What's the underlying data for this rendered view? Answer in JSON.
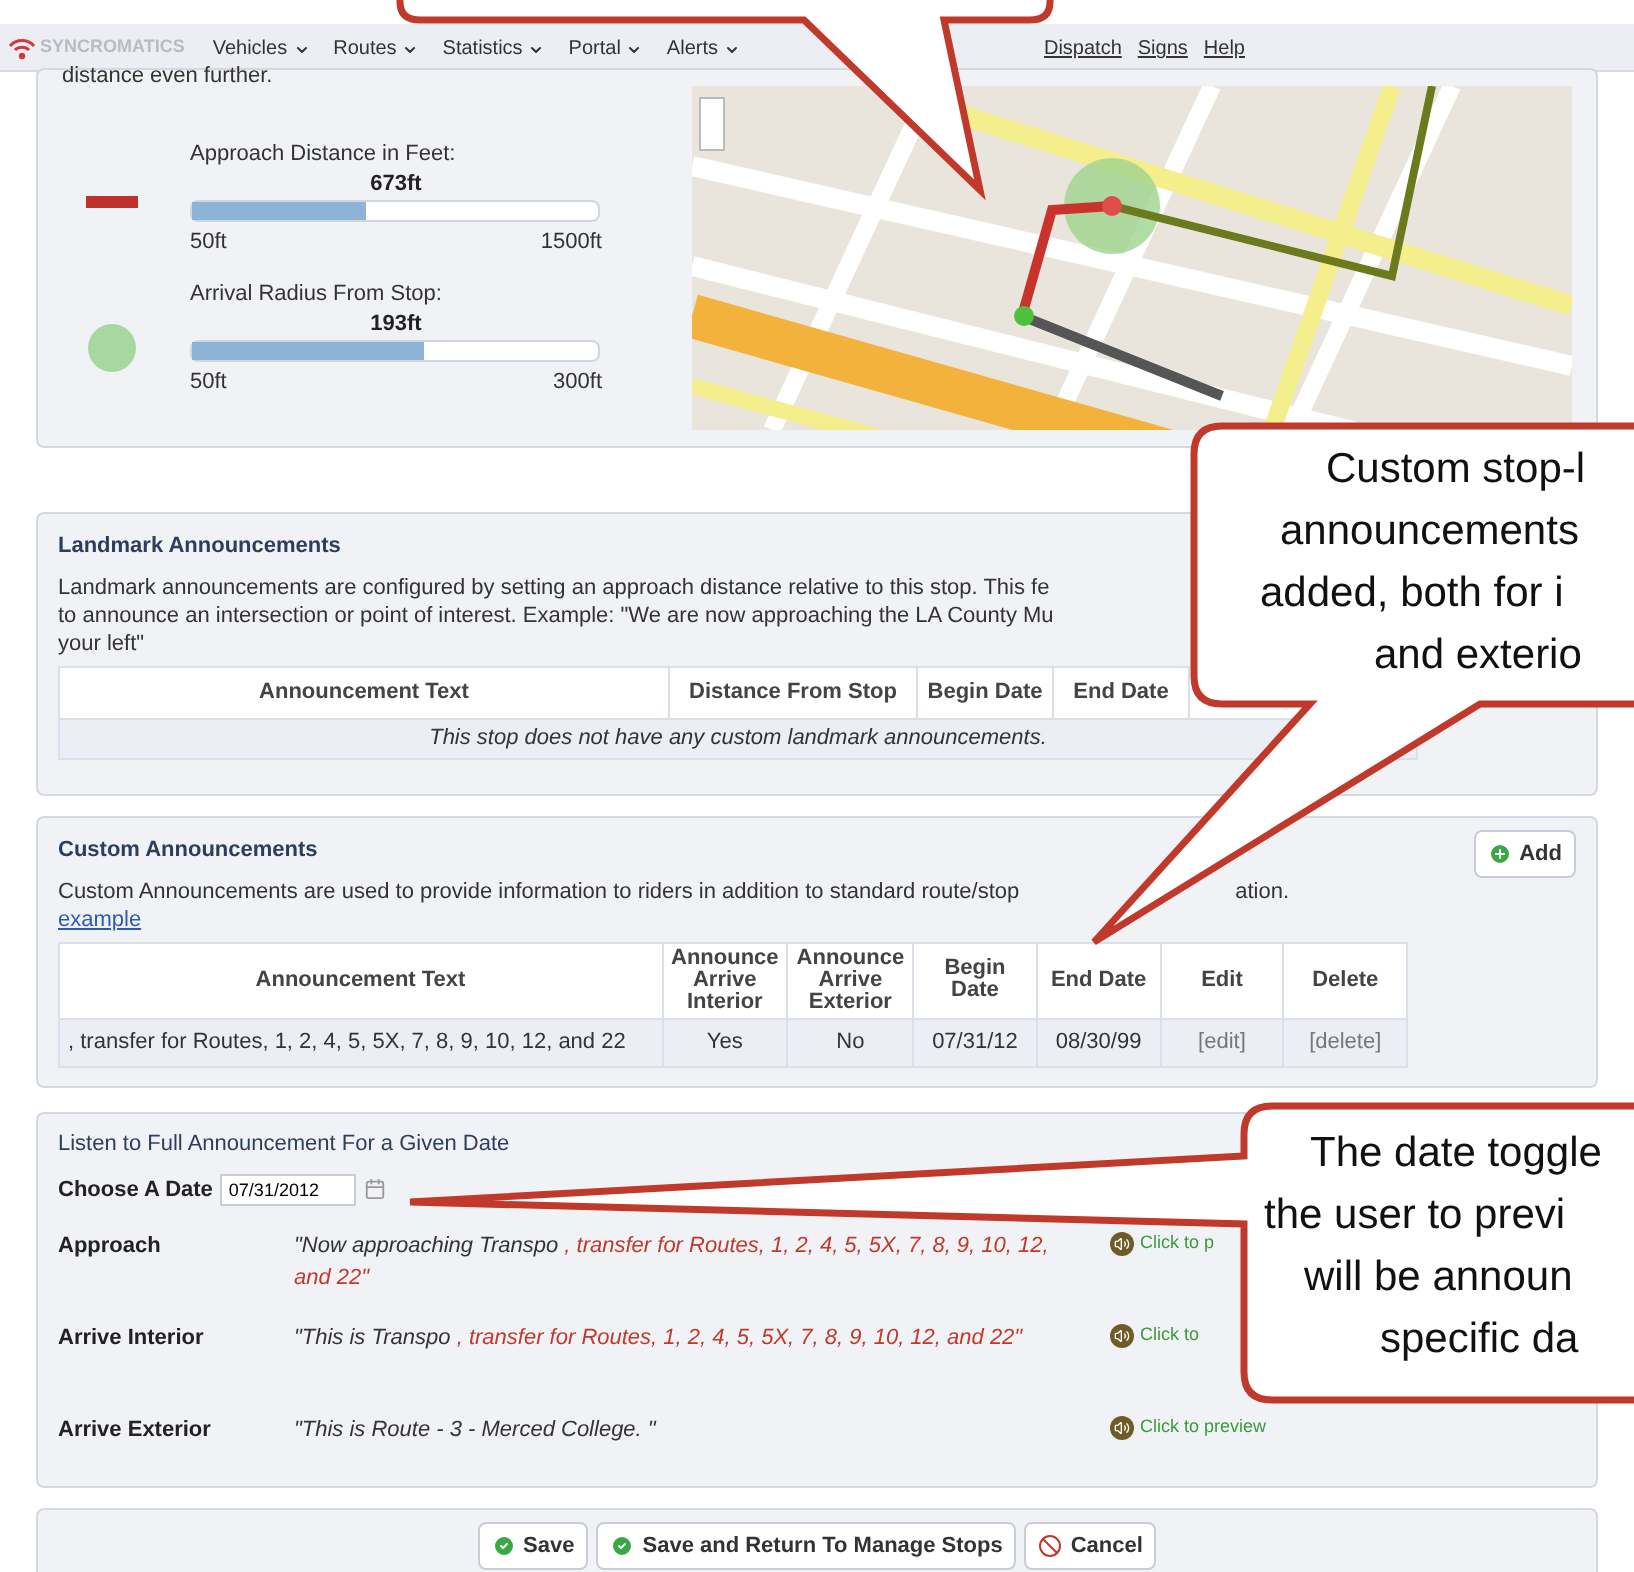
{
  "nav": {
    "logo": "SYNCROMATICS",
    "items": [
      {
        "label": "Vehicles",
        "kind": "menu"
      },
      {
        "label": "Routes",
        "kind": "menu"
      },
      {
        "label": "Statistics",
        "kind": "menu"
      },
      {
        "label": "Portal",
        "kind": "menu"
      },
      {
        "label": "Alerts",
        "kind": "menu"
      },
      {
        "label": "Dispatch",
        "kind": "link"
      },
      {
        "label": "Signs",
        "kind": "link"
      },
      {
        "label": "Help",
        "kind": "link"
      }
    ]
  },
  "distance": {
    "intro": "distance even further.",
    "sliders": [
      {
        "kind": "bar",
        "label": "Approach Distance in Feet:",
        "value": "673ft",
        "level": 0.43,
        "min": "50ft",
        "max": "1500ft"
      },
      {
        "kind": "circle",
        "label": "Arrival Radius From Stop:",
        "value": "193ft",
        "level": 0.57,
        "min": "50ft",
        "max": "300ft"
      }
    ]
  },
  "landmark": {
    "title": "Landmark Announcements",
    "description_lines": [
      "Landmark announcements are configured by setting an approach distance relative to this stop. This fe",
      "to announce an intersection or point of interest. Example: \"We are now approaching the LA County Mu",
      "your left\""
    ],
    "columns": [
      "Announcement Text",
      "Distance From Stop",
      "Begin Date",
      "End Date"
    ],
    "empty_message": "This stop does not have any custom landmark announcements."
  },
  "custom": {
    "title": "Custom Announcements",
    "add_button": "Add",
    "description_parts": [
      "Custom Announcements are used to provide information to riders in addition to standard route/stop",
      "ation."
    ],
    "example_link": "example",
    "columns": [
      "Announcement Text",
      "Announce Arrive Interior",
      "Announce Arrive Exterior",
      "Begin Date",
      "End Date",
      "Edit",
      "Delete"
    ],
    "rows": [
      {
        "text": ", transfer for Routes, 1, 2, 4, 5, 5X, 7, 8, 9, 10, 12, and 22",
        "interior": "Yes",
        "exterior": "No",
        "begin": "07/31/12",
        "end": "08/30/99",
        "edit": "[edit]",
        "delete": "[delete]"
      }
    ]
  },
  "preview": {
    "title": "Listen to Full Announcement For a Given Date",
    "date_label": "Choose A Date",
    "date_value": "07/31/2012",
    "rows": [
      {
        "label": "Approach",
        "parts": [
          {
            "kind": "plain",
            "text": "\"Now approaching Transpo "
          },
          {
            "kind": "custom",
            "text": ", transfer for Routes, 1, 2, 4, 5, 5X, 7, 8, 9, 10, 12, and 22\""
          }
        ],
        "link": "Click to p"
      },
      {
        "label": "Arrive Interior",
        "parts": [
          {
            "kind": "plain",
            "text": "\"This is Transpo "
          },
          {
            "kind": "custom",
            "text": ", transfer for Routes, 1, 2, 4, 5, 5X, 7, 8, 9, 10, 12, and 22\""
          }
        ],
        "link": "Click to"
      },
      {
        "label": "Arrive Exterior",
        "parts": [
          {
            "kind": "plain",
            "text": "\"This is Route - 3 - Merced College. \""
          }
        ],
        "link": "Click to preview"
      }
    ]
  },
  "buttons": [
    {
      "kind": "confirm",
      "label": "Save"
    },
    {
      "kind": "confirm",
      "label": "Save and Return To Manage Stops"
    },
    {
      "kind": "cancel",
      "label": "Cancel"
    }
  ],
  "callouts": [
    {
      "lines": [
        "Custom stop-l",
        "announcements",
        "added, both for i",
        "and exterio"
      ]
    },
    {
      "lines": [
        "The date toggle",
        "the user to previ",
        "will be announ",
        "specific da"
      ]
    }
  ]
}
